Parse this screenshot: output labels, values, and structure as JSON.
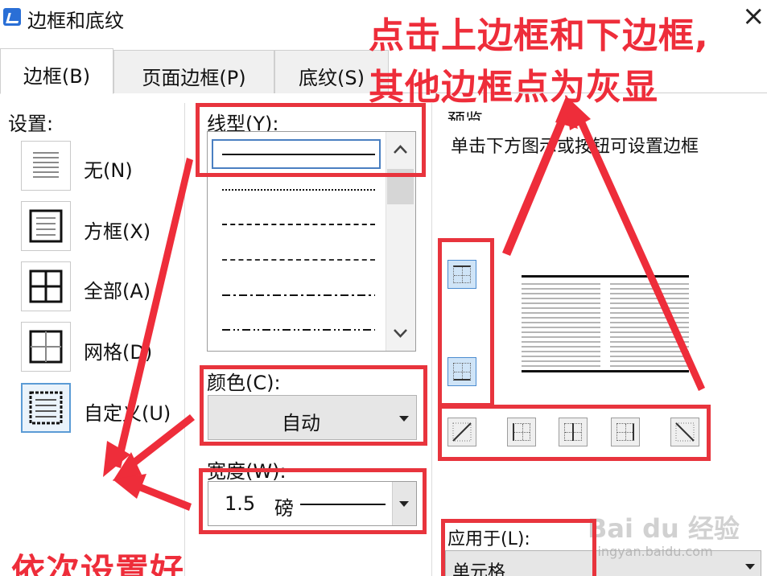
{
  "window": {
    "title": "边框和底纹",
    "close_glyph": "×"
  },
  "tabs": [
    {
      "label": "边框(B)",
      "active": true
    },
    {
      "label": "页面边框(P)",
      "active": false
    },
    {
      "label": "底纹(S)",
      "active": false
    }
  ],
  "settings": {
    "heading": "设置:",
    "presets": [
      {
        "label": "无(N)",
        "icon": "no-border-icon"
      },
      {
        "label": "方框(X)",
        "icon": "box-border-icon"
      },
      {
        "label": "全部(A)",
        "icon": "all-borders-icon"
      },
      {
        "label": "网格(D)",
        "icon": "grid-border-icon"
      },
      {
        "label": "自定义(U)",
        "icon": "custom-border-icon"
      }
    ]
  },
  "line_style": {
    "label": "线型(Y):",
    "options": [
      "solid",
      "dotted",
      "dashed-short",
      "dashed",
      "dash-dot",
      "dash-dot-dot"
    ],
    "selected": "solid"
  },
  "color": {
    "label": "颜色(C):",
    "value": "自动"
  },
  "width": {
    "label": "宽度(W):",
    "value": "1.5",
    "unit": "磅"
  },
  "preview": {
    "label": "预览",
    "hint": "单击下方图示或按钮可设置边框"
  },
  "apply_to": {
    "label": "应用于(L):",
    "value": "单元格"
  },
  "annotations": {
    "top_note_line1": "点击上边框和下边框,",
    "top_note_line2": "其他边框点为灰显",
    "bottom_note": "依次设置好",
    "accent_color": "#e8343d"
  },
  "watermark": {
    "brand": "Bai du 经验",
    "url": "jingyan.baidu.com"
  }
}
